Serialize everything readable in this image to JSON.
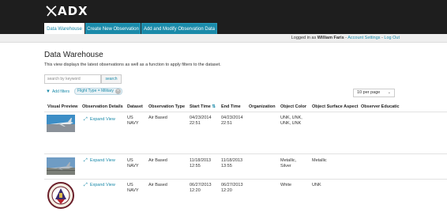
{
  "app": {
    "logo_text": "ADX",
    "logo_icon": "x-swoosh-logo"
  },
  "nav": {
    "tabs": [
      {
        "label": "Data Warehouse",
        "active": true
      },
      {
        "label": "Create New Observation",
        "active": false
      },
      {
        "label": "Add and Modify Observation Data",
        "active": false
      }
    ]
  },
  "userbar": {
    "prefix": "Logged in as ",
    "user": "William Faris",
    "sep1": " - ",
    "account_settings": "Account Settings",
    "sep2": " - ",
    "logout": "Log Out"
  },
  "page": {
    "title": "Data Warehouse",
    "description": "This view displays the latest observations as well as a function to apply filters to the dataset."
  },
  "search": {
    "placeholder": "search by keyword",
    "button": "search"
  },
  "filters": {
    "add_label": "Add filters",
    "add_icon": "funnel-icon",
    "chip_label": "Flight Type = Military",
    "chip_remove_icon": "close-icon"
  },
  "pagination": {
    "per_page": "10 per page"
  },
  "table": {
    "columns": [
      "Visual Preview",
      "Observation Details",
      "Dataset",
      "Observation Type",
      "Start Time",
      "End Time",
      "Organization",
      "Object Color",
      "Object Surface Aspect",
      "Observer Educatic"
    ],
    "sort_icon": "sort-asc-desc-icon",
    "rows": [
      {
        "thumb": "jet-on-runway",
        "details": "Expand View",
        "dataset": [
          "US",
          "NAVY"
        ],
        "type": "Air Based",
        "start": [
          "04/23/2014",
          "22:51"
        ],
        "end": [
          "04/23/2014",
          "22:51"
        ],
        "organization": "",
        "color": [
          "UNK, UNK,",
          "UNK, UNK"
        ],
        "surface": "",
        "education": ""
      },
      {
        "thumb": "jet-taking-off",
        "details": "Expand View",
        "dataset": [
          "US",
          "NAVY"
        ],
        "type": "Air Based",
        "start": [
          "11/18/2013",
          "12:55"
        ],
        "end": [
          "11/18/2013",
          "13:55"
        ],
        "organization": "",
        "color": [
          "Metallic,",
          "Silver"
        ],
        "surface": "Metallic",
        "education": ""
      },
      {
        "thumb": "navy-squadron-patch",
        "details": "Expand View",
        "dataset": [
          "US",
          "NAVY"
        ],
        "type": "Air Based",
        "start": [
          "06/27/2013",
          "12:20"
        ],
        "end": [
          "06/27/2013",
          "12:20"
        ],
        "organization": "",
        "color": [
          "White",
          ""
        ],
        "surface": "UNK",
        "education": ""
      }
    ]
  },
  "colors": {
    "accent": "#1a8aa9",
    "header_bg": "#1e1e1e",
    "userbar_bg": "#eeeeee"
  }
}
